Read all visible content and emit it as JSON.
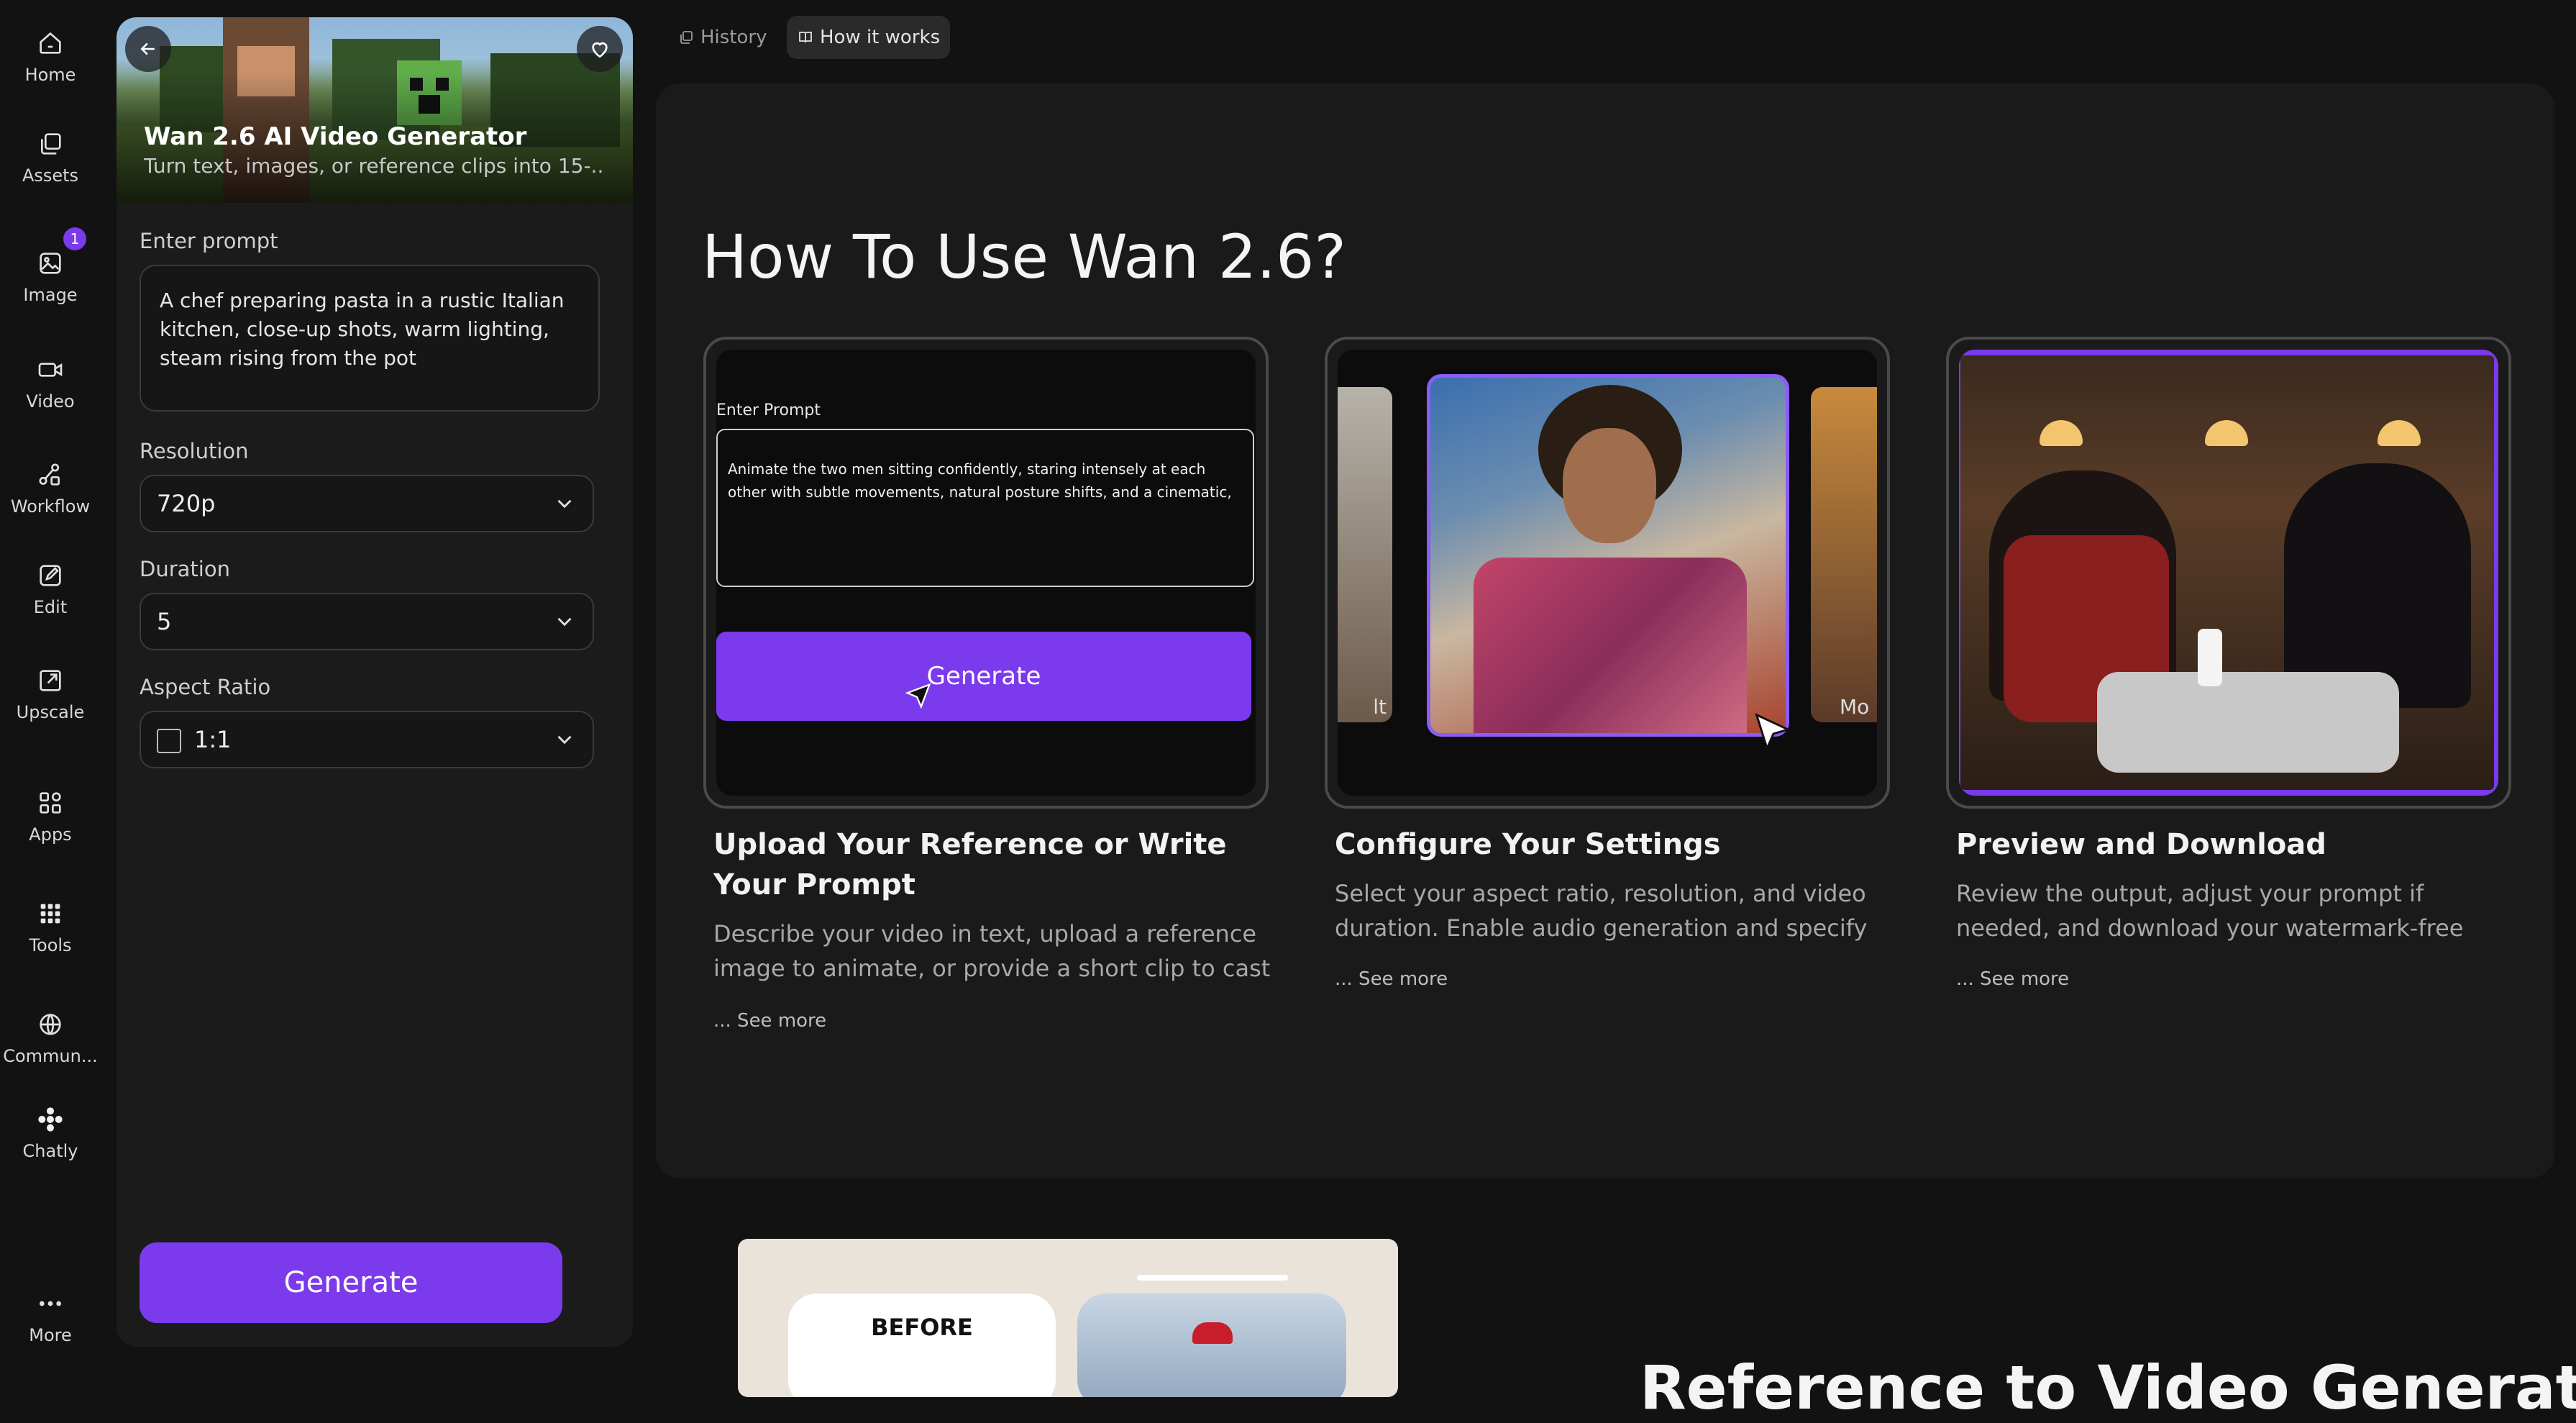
{
  "rail": {
    "items": [
      {
        "label": "Home",
        "icon": "home-icon"
      },
      {
        "label": "Assets",
        "icon": "assets-icon"
      },
      {
        "label": "Image",
        "icon": "image-icon",
        "badge": "1"
      },
      {
        "label": "Video",
        "icon": "video-icon"
      },
      {
        "label": "Workflow",
        "icon": "workflow-icon"
      },
      {
        "label": "Edit",
        "icon": "edit-icon"
      },
      {
        "label": "Upscale",
        "icon": "upscale-icon"
      },
      {
        "label": "Apps",
        "icon": "apps-icon"
      },
      {
        "label": "Tools",
        "icon": "tools-icon"
      },
      {
        "label": "Commun...",
        "icon": "globe-icon"
      },
      {
        "label": "Chatly",
        "icon": "chatly-icon"
      },
      {
        "label": "More",
        "icon": "more-icon"
      }
    ]
  },
  "panel": {
    "title": "Wan 2.6 AI Video Generator",
    "subtitle": "Turn text, images, or reference clips into 15-...",
    "prompt_label": "Enter prompt",
    "prompt_value": "A chef preparing pasta in a rustic Italian kitchen, close-up shots, warm lighting, steam rising from the pot",
    "resolution_label": "Resolution",
    "resolution_value": "720p",
    "duration_label": "Duration",
    "duration_value": "5",
    "aspect_label": "Aspect Ratio",
    "aspect_value": "1:1",
    "generate_label": "Generate"
  },
  "tabs": [
    {
      "label": "History",
      "icon": "history-icon",
      "active": false
    },
    {
      "label": "How it works",
      "icon": "book-icon",
      "active": true
    }
  ],
  "how": {
    "title": "How To Use Wan 2.6?",
    "demo": {
      "prompt_label": "Enter Prompt",
      "prompt_text": "Animate the two men sitting confidently, staring intensely at each other with subtle movements, natural posture shifts, and a cinematic,",
      "generate_label": "Generate",
      "side_left": "lt",
      "side_right": "Mo"
    },
    "steps": [
      {
        "title": "Upload Your Reference or Write Your Prompt",
        "desc": "Describe your video in text, upload a reference image to animate, or provide a short clip to cast",
        "more": "... See more"
      },
      {
        "title": "Configure Your Settings",
        "desc": "Select your aspect ratio, resolution, and video duration. Enable audio generation and specify",
        "more": "... See more"
      },
      {
        "title": "Preview and Download",
        "desc": "Review the output, adjust your prompt if needed, and download your watermark-free",
        "more": "... See more"
      }
    ]
  },
  "below": {
    "before_label": "BEFORE",
    "heading": "Reference to Video Generation"
  },
  "colors": {
    "accent": "#7c3aed",
    "background": "#121212",
    "panel": "#1b1b1b"
  }
}
